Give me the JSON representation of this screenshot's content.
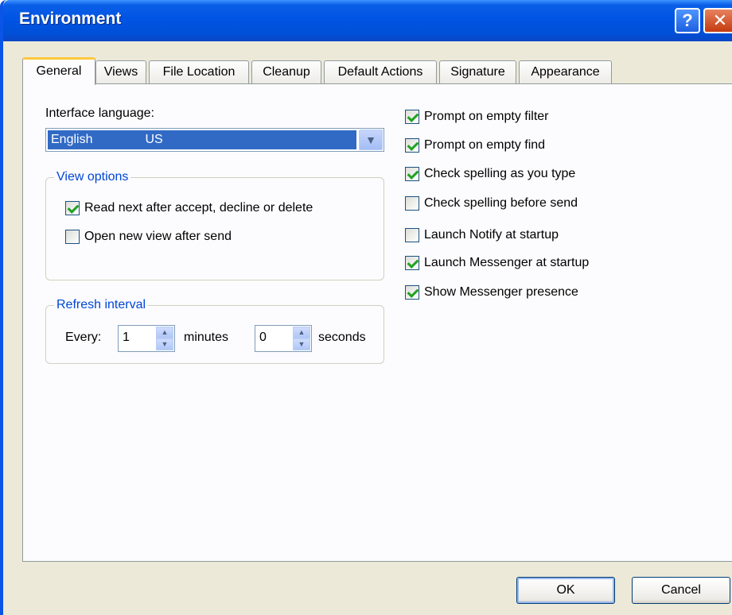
{
  "window": {
    "title": "Environment",
    "help_glyph": "?",
    "close_glyph": "✕"
  },
  "tabs": [
    {
      "label": "General",
      "active": true
    },
    {
      "label": "Views"
    },
    {
      "label": "File Location"
    },
    {
      "label": "Cleanup"
    },
    {
      "label": "Default Actions"
    },
    {
      "label": "Signature"
    },
    {
      "label": "Appearance"
    }
  ],
  "general": {
    "language_label": "Interface language:",
    "language_value_1": "English",
    "language_value_2": "US",
    "view_options": {
      "title": "View options",
      "read_next": {
        "label": "Read next after accept, decline or delete",
        "checked": true
      },
      "open_new_view": {
        "label": "Open new view after send",
        "checked": false
      }
    },
    "refresh": {
      "title": "Refresh interval",
      "every_label": "Every:",
      "minutes_value": "1",
      "minutes_label": "minutes",
      "seconds_value": "0",
      "seconds_label": "seconds"
    },
    "options": [
      {
        "label": "Prompt on empty filter",
        "checked": true
      },
      {
        "label": "Prompt on empty find",
        "checked": true
      },
      {
        "label": "Check spelling as you type",
        "checked": true
      },
      {
        "label": "Check spelling before send",
        "checked": false
      },
      {
        "label": "Launch Notify at startup",
        "checked": false
      },
      {
        "label": "Launch Messenger at startup",
        "checked": true
      },
      {
        "label": "Show Messenger presence",
        "checked": true
      }
    ]
  },
  "buttons": {
    "ok": "OK",
    "cancel": "Cancel"
  }
}
